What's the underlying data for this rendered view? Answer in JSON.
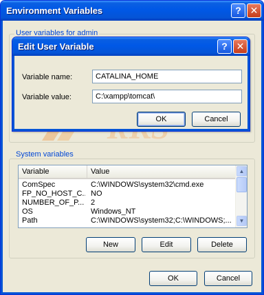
{
  "window": {
    "title": "Environment Variables",
    "help_glyph": "?",
    "close_glyph": "✕",
    "user_group_label": "User variables for admin"
  },
  "dialog": {
    "title": "Edit User Variable",
    "help_glyph": "?",
    "close_glyph": "✕",
    "name_label": "Variable name:",
    "name_value": "CATALINA_HOME",
    "value_label": "Variable value:",
    "value_value": "C:\\xampp\\tomcat\\",
    "ok_label": "OK",
    "cancel_label": "Cancel"
  },
  "watermark": {
    "text": "RKS"
  },
  "system": {
    "group_label": "System variables",
    "columns": [
      "Variable",
      "Value"
    ],
    "rows": [
      {
        "name": "ComSpec",
        "value": "C:\\WINDOWS\\system32\\cmd.exe"
      },
      {
        "name": "FP_NO_HOST_C...",
        "value": "NO"
      },
      {
        "name": "NUMBER_OF_P...",
        "value": "2"
      },
      {
        "name": "OS",
        "value": "Windows_NT"
      },
      {
        "name": "Path",
        "value": "C:\\WINDOWS\\system32;C:\\WINDOWS;..."
      }
    ],
    "new_label": "New",
    "edit_label": "Edit",
    "delete_label": "Delete"
  },
  "footer": {
    "ok_label": "OK",
    "cancel_label": "Cancel"
  },
  "colors": {
    "title_bar": "#0554d6",
    "group_label": "#0046d5",
    "close_button": "#c73d1a",
    "window_background": "#ece9d8"
  },
  "icons": {
    "help": "help-icon",
    "close": "close-icon",
    "scroll_up": "scroll-up-arrow-icon",
    "scroll_down": "scroll-down-arrow-icon"
  }
}
